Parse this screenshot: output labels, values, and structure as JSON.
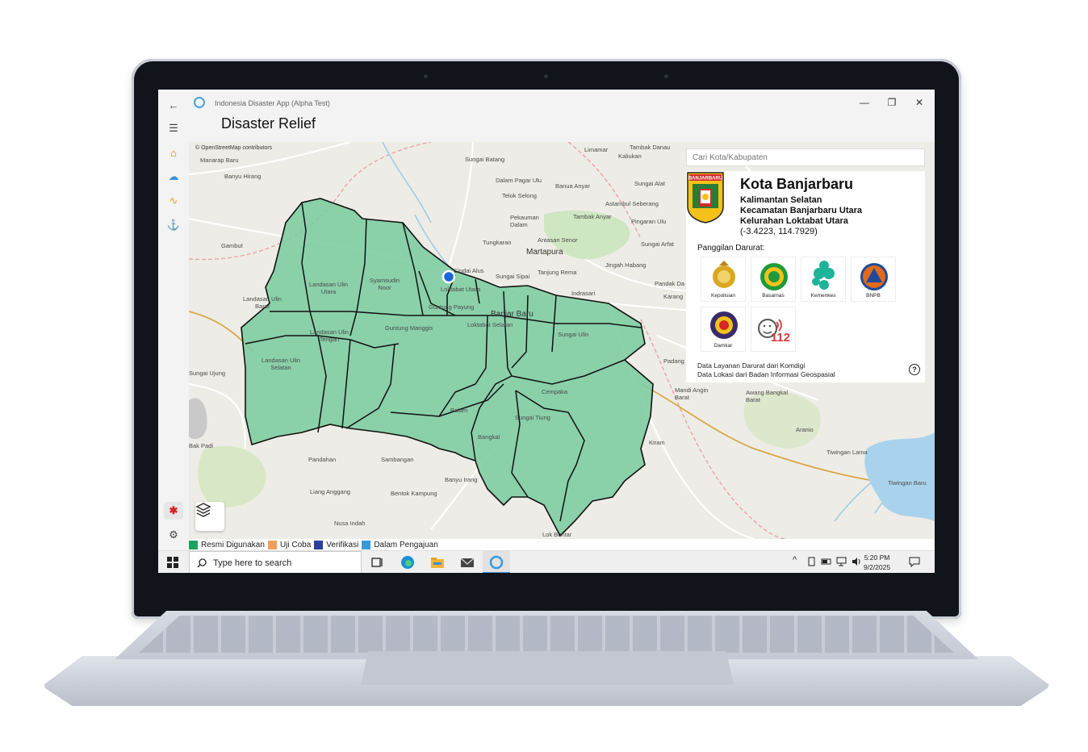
{
  "app": {
    "title": "Indonesia Disaster App (Alpha Test)",
    "page_title": "Disaster Relief",
    "window_controls": {
      "minimize": "—",
      "maximize": "❐",
      "close": "✕"
    },
    "rail_icons": [
      "back-arrow-icon",
      "hamburger-icon",
      "home-icon",
      "cloud-icon",
      "pulse-icon",
      "anchor-icon",
      "star-icon",
      "gear-icon"
    ]
  },
  "map": {
    "attribution": "© OpenStreetMap contributors",
    "labels": {
      "l1": "Landasan Ulin Barat",
      "l2": "Landasan Ulin Utara",
      "l3": "Syamsudin Noor",
      "l4": "Loktabat Utara",
      "l5": "Guntung Payung",
      "l6": "Guntung Manggis",
      "l7": "Landasan Ulin Tengah",
      "l8": "Landasan Ulin Selatan",
      "l9": "Sungai Ulin",
      "l10": "Cempaka",
      "l11": "Palam",
      "l12": "Sungai Tiung",
      "l13": "Bangkal",
      "l14": "Martapura",
      "l15": "Cindai Alus",
      "l16": "Sungai Sipai",
      "l17": "Tanjung Rema",
      "l18": "Indrasari",
      "l19": "Banjar Baru",
      "l20": "Loktabat Selatan",
      "l21": "Manarap Baru",
      "l22": "Banyu Hirang",
      "l23": "Gambut",
      "l24": "Kiram",
      "l25": "Aranio",
      "l26": "Tiwingan Lama",
      "l27": "Tiwingan Baru",
      "l28": "Awang Bangkal Barat",
      "l29": "Mandi Angin Barat",
      "l30": "Padang",
      "l31": "Karang",
      "l32": "Pandak Da",
      "l33": "Sungai Arfat",
      "l34": "Pingaran Ulu",
      "l35": "Jingah Habang",
      "l36": "Tungkaran",
      "l37": "Pekauman Dalam",
      "l38": "Telok Selong",
      "l39": "Dalam Pagar Ulu",
      "l40": "Sungai Batang",
      "l41": "Tambak Danau",
      "l42": "Limamar",
      "l43": "Kaliukan",
      "l44": "Banua Anyar",
      "l45": "Sungai Alat",
      "l46": "Astambul Seberang",
      "l47": "Tambak Anyar",
      "l48": "Antasan Senor",
      "l49": "Sambangan",
      "l50": "Pandahan",
      "l51": "Liang Anggang",
      "l52": "Bentok Kampung",
      "l53": "Banyu Irang",
      "l54": "Nusa Indah",
      "l55": "Sungai Ujung",
      "l56": "Bak Padi",
      "l57": "Lok Buntar"
    }
  },
  "legend": [
    {
      "label": "Resmi Digunakan",
      "color": "#1aa260"
    },
    {
      "label": "Uji Coba",
      "color": "#f0a05a"
    },
    {
      "label": "Verifikasi",
      "color": "#2c3e9e"
    },
    {
      "label": "Dalam Pengajuan",
      "color": "#3a9ad9"
    }
  ],
  "search": {
    "placeholder": "Cari Kota/Kabupaten"
  },
  "info": {
    "city": "Kota Banjarbaru",
    "crest_label": "BANJARBARU",
    "province": "Kalimantan Selatan",
    "kecamatan": "Kecamatan Banjarbaru Utara",
    "kelurahan": "Kelurahan Loktabat Utara",
    "coords": "(-3.4223, 114.7929)",
    "emergency_label": "Panggilan Darurat:",
    "services": [
      {
        "name": "Kepolisian",
        "icon": "police-icon",
        "color": "#c99a1e"
      },
      {
        "name": "Basarnas",
        "icon": "basarnas-icon",
        "color": "#1e9a3a"
      },
      {
        "name": "Kemenkes",
        "icon": "kemenkes-icon",
        "color": "#1fb39a"
      },
      {
        "name": "BNPB",
        "icon": "bnpb-icon",
        "color": "#e06a1a"
      },
      {
        "name": "Damkar",
        "icon": "damkar-icon",
        "color": "#3a2a6a"
      },
      {
        "name": "112",
        "icon": "call-112-icon",
        "color": "#d63a3a"
      }
    ],
    "source1": "Data Layanan Darurat dari Komdigi",
    "source2": "Data Lokasi dari Badan Informasi Geospasial",
    "help": "?"
  },
  "taskbar": {
    "search_placeholder": "Type here to search",
    "time": "5:20 PM",
    "date": "9/2/2025",
    "tray_chevron": "^"
  }
}
